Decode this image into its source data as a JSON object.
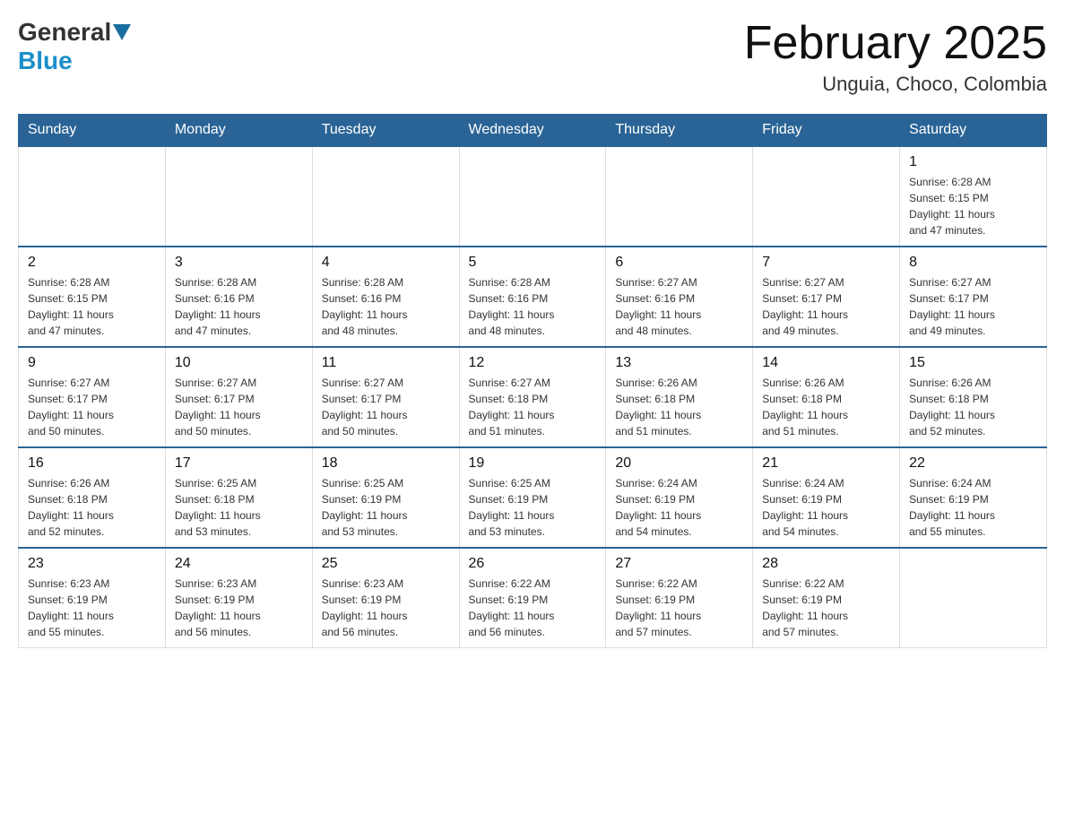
{
  "header": {
    "logo_general": "General",
    "logo_blue": "Blue",
    "month_title": "February 2025",
    "location": "Unguia, Choco, Colombia"
  },
  "weekdays": [
    "Sunday",
    "Monday",
    "Tuesday",
    "Wednesday",
    "Thursday",
    "Friday",
    "Saturday"
  ],
  "weeks": [
    [
      {
        "day": "",
        "info": ""
      },
      {
        "day": "",
        "info": ""
      },
      {
        "day": "",
        "info": ""
      },
      {
        "day": "",
        "info": ""
      },
      {
        "day": "",
        "info": ""
      },
      {
        "day": "",
        "info": ""
      },
      {
        "day": "1",
        "info": "Sunrise: 6:28 AM\nSunset: 6:15 PM\nDaylight: 11 hours\nand 47 minutes."
      }
    ],
    [
      {
        "day": "2",
        "info": "Sunrise: 6:28 AM\nSunset: 6:15 PM\nDaylight: 11 hours\nand 47 minutes."
      },
      {
        "day": "3",
        "info": "Sunrise: 6:28 AM\nSunset: 6:16 PM\nDaylight: 11 hours\nand 47 minutes."
      },
      {
        "day": "4",
        "info": "Sunrise: 6:28 AM\nSunset: 6:16 PM\nDaylight: 11 hours\nand 48 minutes."
      },
      {
        "day": "5",
        "info": "Sunrise: 6:28 AM\nSunset: 6:16 PM\nDaylight: 11 hours\nand 48 minutes."
      },
      {
        "day": "6",
        "info": "Sunrise: 6:27 AM\nSunset: 6:16 PM\nDaylight: 11 hours\nand 48 minutes."
      },
      {
        "day": "7",
        "info": "Sunrise: 6:27 AM\nSunset: 6:17 PM\nDaylight: 11 hours\nand 49 minutes."
      },
      {
        "day": "8",
        "info": "Sunrise: 6:27 AM\nSunset: 6:17 PM\nDaylight: 11 hours\nand 49 minutes."
      }
    ],
    [
      {
        "day": "9",
        "info": "Sunrise: 6:27 AM\nSunset: 6:17 PM\nDaylight: 11 hours\nand 50 minutes."
      },
      {
        "day": "10",
        "info": "Sunrise: 6:27 AM\nSunset: 6:17 PM\nDaylight: 11 hours\nand 50 minutes."
      },
      {
        "day": "11",
        "info": "Sunrise: 6:27 AM\nSunset: 6:17 PM\nDaylight: 11 hours\nand 50 minutes."
      },
      {
        "day": "12",
        "info": "Sunrise: 6:27 AM\nSunset: 6:18 PM\nDaylight: 11 hours\nand 51 minutes."
      },
      {
        "day": "13",
        "info": "Sunrise: 6:26 AM\nSunset: 6:18 PM\nDaylight: 11 hours\nand 51 minutes."
      },
      {
        "day": "14",
        "info": "Sunrise: 6:26 AM\nSunset: 6:18 PM\nDaylight: 11 hours\nand 51 minutes."
      },
      {
        "day": "15",
        "info": "Sunrise: 6:26 AM\nSunset: 6:18 PM\nDaylight: 11 hours\nand 52 minutes."
      }
    ],
    [
      {
        "day": "16",
        "info": "Sunrise: 6:26 AM\nSunset: 6:18 PM\nDaylight: 11 hours\nand 52 minutes."
      },
      {
        "day": "17",
        "info": "Sunrise: 6:25 AM\nSunset: 6:18 PM\nDaylight: 11 hours\nand 53 minutes."
      },
      {
        "day": "18",
        "info": "Sunrise: 6:25 AM\nSunset: 6:19 PM\nDaylight: 11 hours\nand 53 minutes."
      },
      {
        "day": "19",
        "info": "Sunrise: 6:25 AM\nSunset: 6:19 PM\nDaylight: 11 hours\nand 53 minutes."
      },
      {
        "day": "20",
        "info": "Sunrise: 6:24 AM\nSunset: 6:19 PM\nDaylight: 11 hours\nand 54 minutes."
      },
      {
        "day": "21",
        "info": "Sunrise: 6:24 AM\nSunset: 6:19 PM\nDaylight: 11 hours\nand 54 minutes."
      },
      {
        "day": "22",
        "info": "Sunrise: 6:24 AM\nSunset: 6:19 PM\nDaylight: 11 hours\nand 55 minutes."
      }
    ],
    [
      {
        "day": "23",
        "info": "Sunrise: 6:23 AM\nSunset: 6:19 PM\nDaylight: 11 hours\nand 55 minutes."
      },
      {
        "day": "24",
        "info": "Sunrise: 6:23 AM\nSunset: 6:19 PM\nDaylight: 11 hours\nand 56 minutes."
      },
      {
        "day": "25",
        "info": "Sunrise: 6:23 AM\nSunset: 6:19 PM\nDaylight: 11 hours\nand 56 minutes."
      },
      {
        "day": "26",
        "info": "Sunrise: 6:22 AM\nSunset: 6:19 PM\nDaylight: 11 hours\nand 56 minutes."
      },
      {
        "day": "27",
        "info": "Sunrise: 6:22 AM\nSunset: 6:19 PM\nDaylight: 11 hours\nand 57 minutes."
      },
      {
        "day": "28",
        "info": "Sunrise: 6:22 AM\nSunset: 6:19 PM\nDaylight: 11 hours\nand 57 minutes."
      },
      {
        "day": "",
        "info": ""
      }
    ]
  ]
}
